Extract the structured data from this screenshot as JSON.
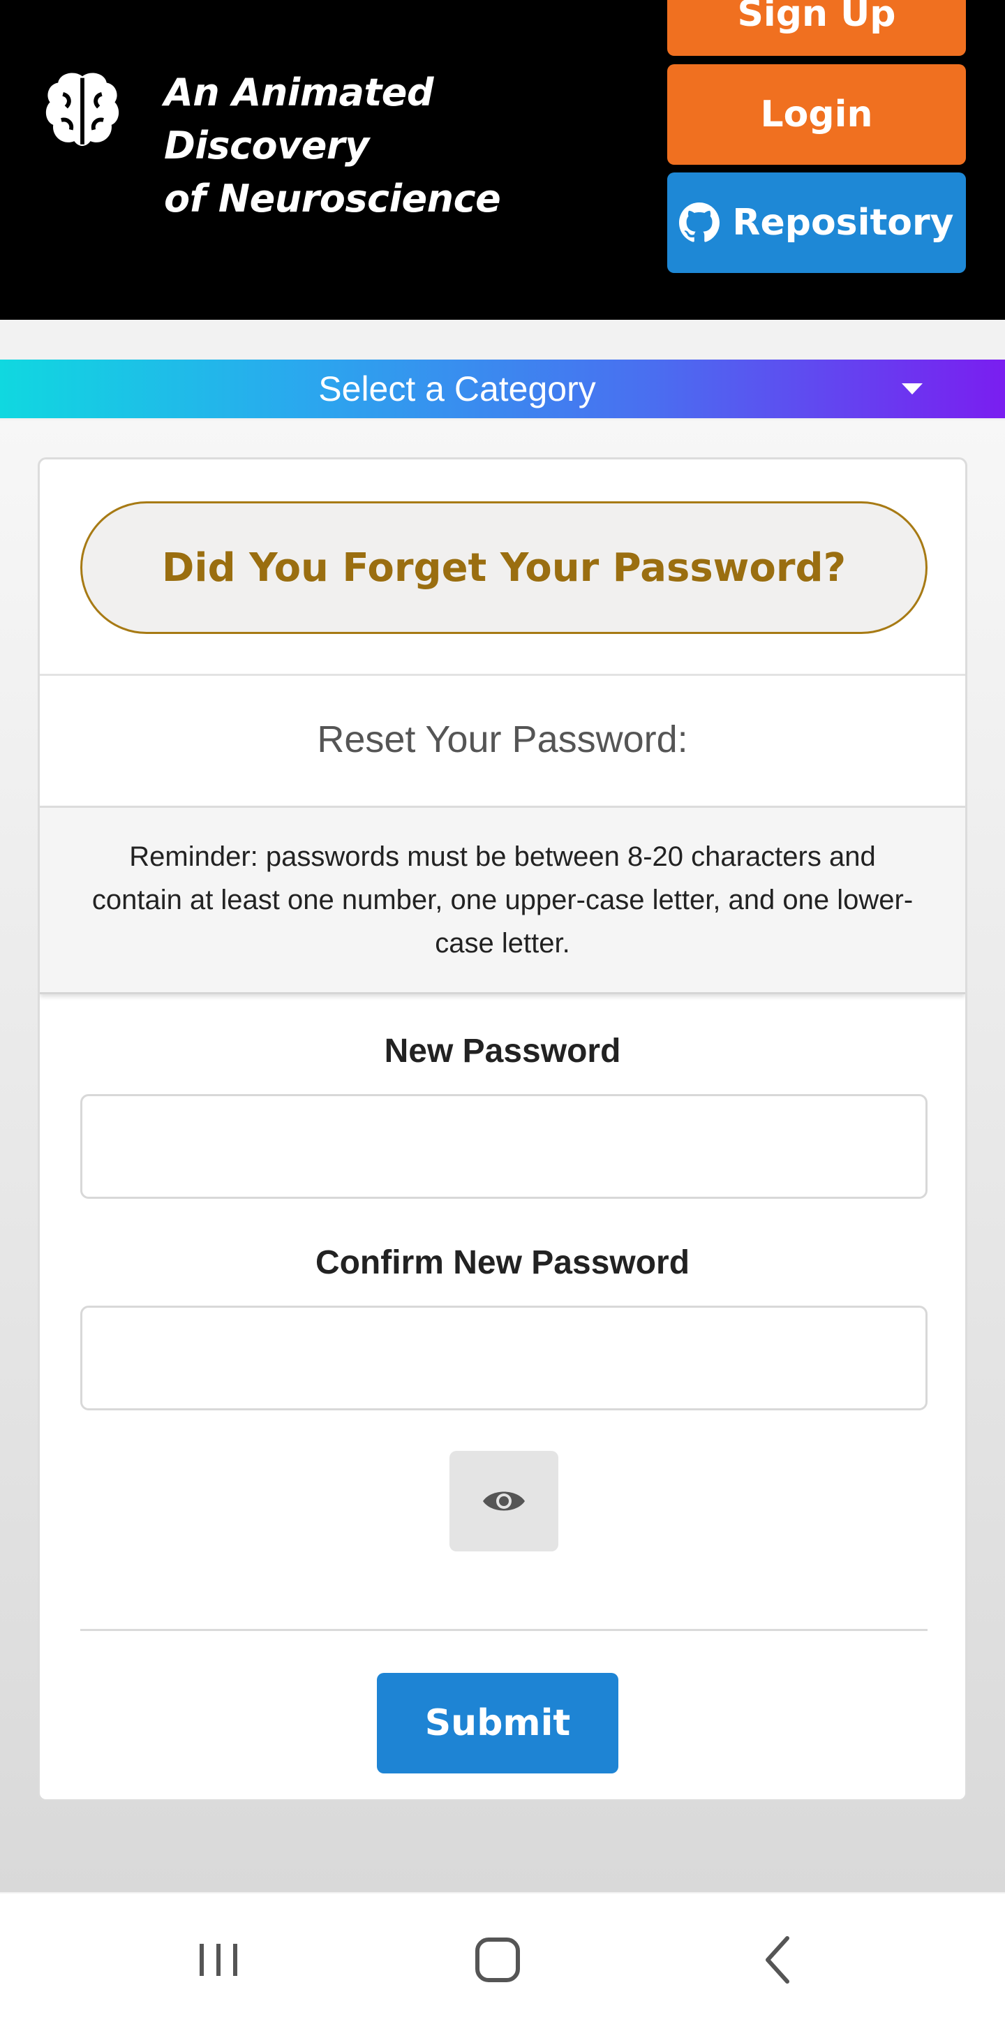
{
  "header": {
    "logo_icon": "brain-icon",
    "title_line1": "An Animated Discovery",
    "title_line2": "of Neuroscience",
    "signup_label": "Sign Up",
    "login_label": "Login",
    "repository_label": "Repository",
    "repository_icon": "github-icon"
  },
  "category": {
    "label": "Select a Category",
    "icon": "caret-down-icon"
  },
  "card": {
    "forgot_heading": "Did You Forget Your Password?",
    "reset_title": "Reset Your Password:",
    "reminder": "Reminder: passwords must be between 8-20 characters and contain at least one number, one upper-case letter, and one lower-case letter.",
    "new_password_label": "New Password",
    "new_password_value": "",
    "confirm_password_label": "Confirm New Password",
    "confirm_password_value": "",
    "toggle_icon": "eye-icon",
    "submit_label": "Submit"
  },
  "nav": {
    "recents_icon": "recents-icon",
    "home_icon": "home-icon",
    "back_icon": "back-icon"
  },
  "colors": {
    "header_bg": "#000000",
    "orange": "#f07020",
    "blue": "#1e88d6",
    "gold": "#9a6e10",
    "gradient_start": "#10d8e0",
    "gradient_end": "#7a1ef0"
  }
}
